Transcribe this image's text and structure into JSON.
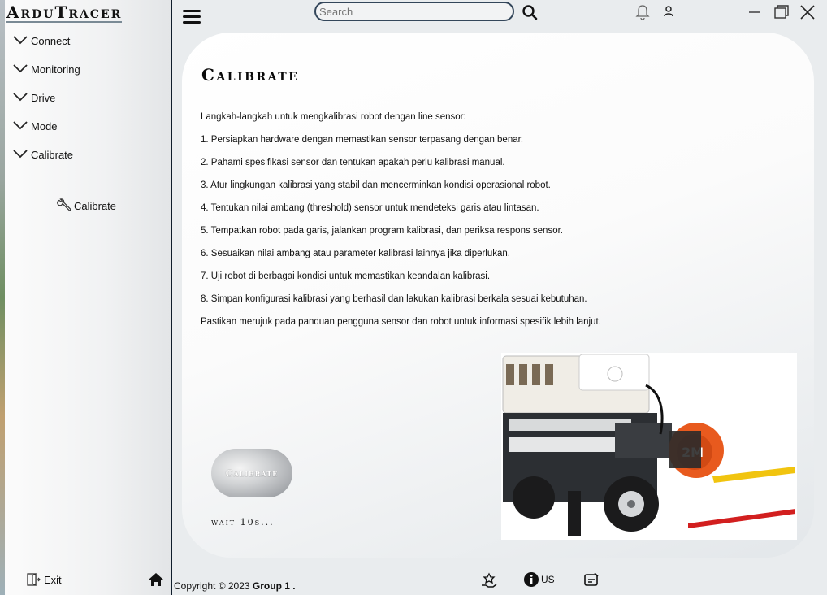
{
  "app": {
    "name": "ArduTracer"
  },
  "sidebar": {
    "items": [
      {
        "label": "Connect"
      },
      {
        "label": "Monitoring"
      },
      {
        "label": "Drive"
      },
      {
        "label": "Mode"
      },
      {
        "label": "Calibrate"
      }
    ],
    "sub_item": {
      "label": "Calibrate",
      "icon": "wrench-icon"
    },
    "exit_label": "Exit"
  },
  "topbar": {
    "search_placeholder": "Search"
  },
  "main": {
    "title": "Calibrate",
    "intro": "Langkah-langkah untuk mengkalibrasi robot dengan line sensor:",
    "steps": [
      "1. Persiapkan hardware dengan memastikan sensor terpasang dengan benar.",
      "2. Pahami spesifikasi sensor dan tentukan apakah perlu kalibrasi manual.",
      "3. Atur lingkungan kalibrasi yang stabil dan mencerminkan kondisi operasional robot.",
      "4. Tentukan nilai ambang (threshold) sensor untuk mendeteksi garis atau lintasan.",
      "5. Tempatkan robot pada garis, jalankan program kalibrasi, dan periksa respons sensor.",
      "6. Sesuaikan nilai ambang atau parameter kalibrasi lainnya jika diperlukan.",
      "7. Uji robot di berbagai kondisi untuk memastikan keandalan kalibrasi.",
      "8. Simpan konfigurasi kalibrasi yang berhasil dan lakukan kalibrasi berkala sesuai kebutuhan."
    ],
    "note": "Pastikan merujuk pada panduan pengguna sensor dan robot untuk informasi spesifik lebih lanjut.",
    "calibrate_button": "Calibrate",
    "wait_text": "wait 10s...",
    "tape_label": "2M"
  },
  "footer": {
    "copyright": "Copyright © 2023 ",
    "group": "Group 1 .",
    "us_label": "US"
  }
}
